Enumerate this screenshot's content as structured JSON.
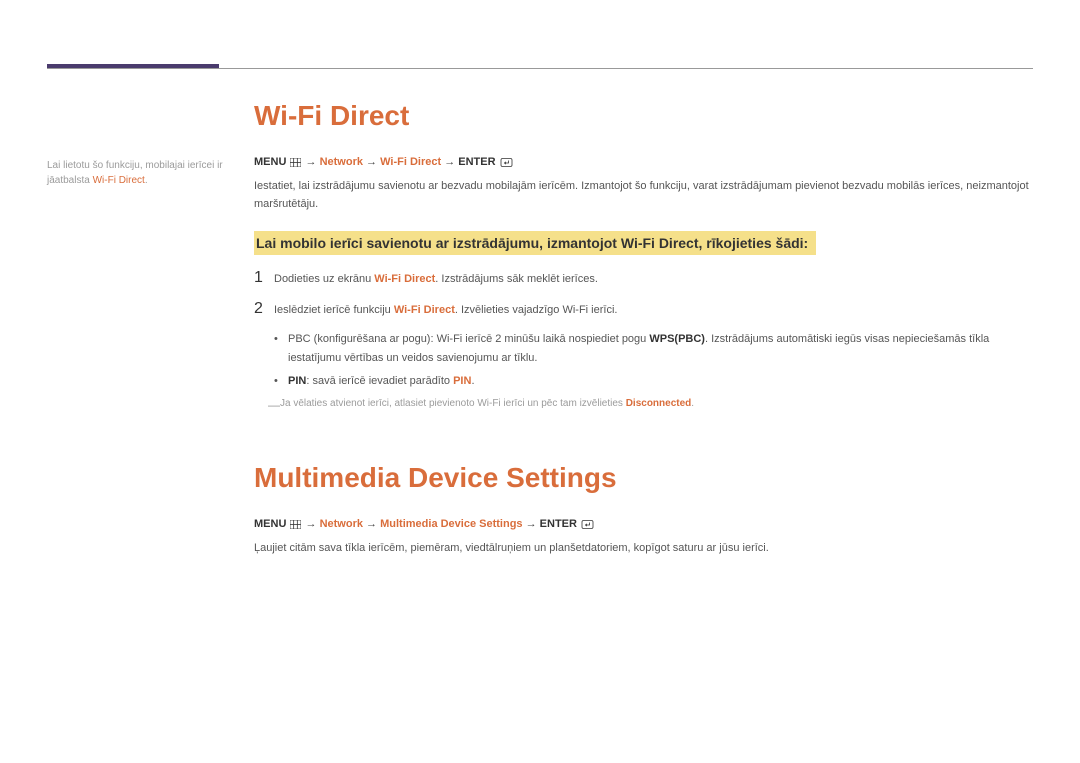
{
  "sidebar": {
    "prefix": "Lai lietotu šo funkciju, mobilajai ierīcei ir jāatbalsta ",
    "highlight": "Wi-Fi Direct",
    "suffix": "."
  },
  "section1": {
    "heading": "Wi-Fi Direct",
    "path": {
      "menu": "MENU",
      "p1": "Network",
      "p2": "Wi-Fi Direct",
      "enter": "ENTER"
    },
    "intro": "Iestatiet, lai izstrādājumu savienotu ar bezvadu mobilajām ierīcēm. Izmantojot šo funkciju, varat izstrādājumam pievienot bezvadu mobilās ierīces, neizmantojot maršrutētāju.",
    "subhead": "Lai mobilo ierīci savienotu ar izstrādājumu, izmantojot Wi-Fi Direct, rīkojieties šādi:",
    "steps": [
      {
        "num": "1",
        "pre": "Dodieties uz ekrānu ",
        "hl": "Wi-Fi Direct",
        "post": ". Izstrādājums sāk meklēt ierīces."
      },
      {
        "num": "2",
        "pre": "Ieslēdziet ierīcē funkciju ",
        "hl": "Wi-Fi Direct",
        "post": ". Izvēlieties vajadzīgo Wi-Fi ierīci."
      }
    ],
    "bullets": [
      {
        "pre": "PBC (konfigurēšana ar pogu): Wi-Fi ierīcē 2 minūšu laikā nospiediet pogu ",
        "hl": "WPS(PBC)",
        "post": ". Izstrādājums automātiski iegūs visas nepieciešamās tīkla iestatījumu vērtības un veidos savienojumu ar tīklu."
      },
      {
        "lbl": "PIN",
        "mid": ": savā ierīcē ievadiet parādīto ",
        "hl": "PIN",
        "post": "."
      }
    ],
    "footnote": {
      "dash": "―",
      "pre": "Ja vēlaties atvienot ierīci, atlasiet pievienoto Wi-Fi ierīci un pēc tam izvēlieties ",
      "hl": "Disconnected",
      "post": "."
    }
  },
  "section2": {
    "heading": "Multimedia Device Settings",
    "path": {
      "menu": "MENU",
      "p1": "Network",
      "p2": "Multimedia Device Settings",
      "enter": "ENTER"
    },
    "body": "Ļaujiet citām sava tīkla ierīcēm, piemēram, viedtālruņiem un planšetdatoriem, kopīgot saturu ar jūsu ierīci."
  },
  "arrow": "→"
}
